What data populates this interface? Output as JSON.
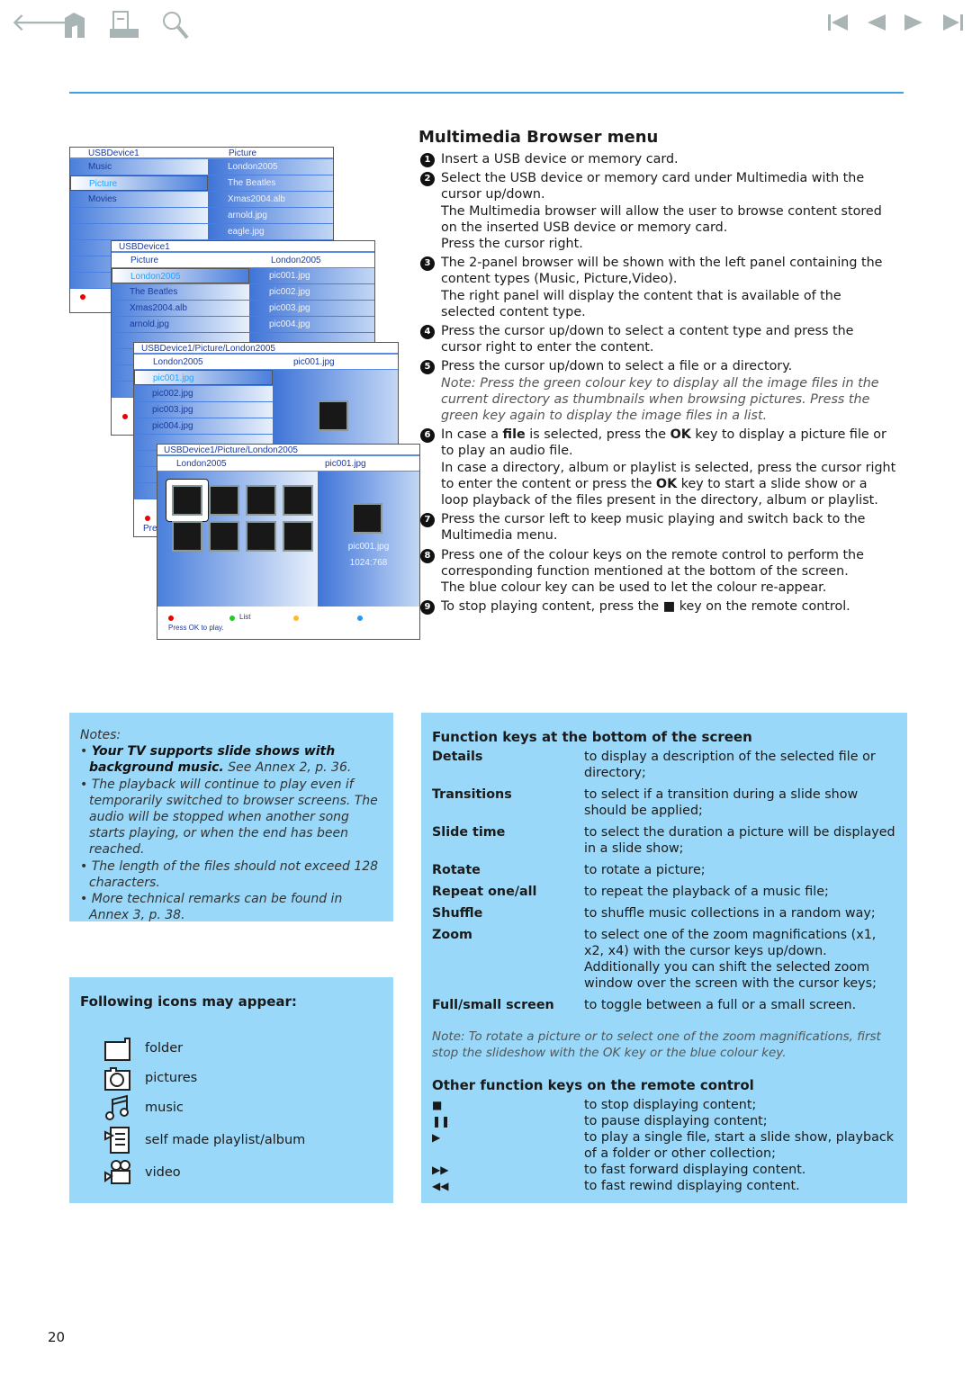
{
  "nav": {
    "left_icons": [
      "back-arrow-icon",
      "home-icon",
      "print-icon",
      "search-icon"
    ],
    "right_icons": [
      "first-page-icon",
      "previous-page-icon",
      "next-page-icon",
      "last-page-icon"
    ]
  },
  "colors": {
    "rule": "#3aa2e6",
    "box": "#99d8f8",
    "screen_blue": "#4a7fdc"
  },
  "screens": [
    {
      "header_left": "USBDevice1",
      "header_right": "Picture",
      "left": [
        "Music",
        "Picture",
        "Movies",
        "",
        ""
      ],
      "right": [
        "London2005",
        "The Beatles",
        "Xmas2004.alb",
        "arnold.jpg",
        "eagle.jpg"
      ],
      "selected": 1
    },
    {
      "header": "USBDevice1",
      "sub_left": "Picture",
      "sub_right": "London2005",
      "left": [
        "London2005",
        "The Beatles",
        "Xmas2004.alb",
        "arnold.jpg"
      ],
      "right": [
        "pic001.jpg",
        "pic002.jpg",
        "pic003.jpg",
        "pic004.jpg"
      ],
      "foot": "Pre"
    },
    {
      "header": "USBDevice1/Picture/London2005",
      "sub_left": "London2005",
      "sub_right": "pic001.jpg",
      "left": [
        "pic001.jpg",
        "pic002.jpg",
        "pic003.jpg",
        "pic004.jpg"
      ],
      "foot": "Pre"
    },
    {
      "header": "USBDevice1/Picture/London2005",
      "sub_left": "London2005",
      "sub_right": "pic001.jpg",
      "preview_name": "pic001.jpg",
      "preview_res": "1024:768",
      "green_label": "List",
      "foot": "Press OK to play."
    }
  ],
  "main": {
    "title": "Multimedia Browser menu",
    "steps": [
      {
        "n": "1",
        "lines": [
          "Insert a USB device or memory card."
        ]
      },
      {
        "n": "2",
        "lines": [
          "Select the USB device or memory card under Multimedia with the cursor up/down.",
          "The Multimedia browser will allow the user to browse content stored on the inserted USB device or memory card.",
          "Press the cursor right."
        ]
      },
      {
        "n": "3",
        "lines": [
          "The 2-panel browser will be shown with the left panel containing the content types (Music, Picture,Video).",
          "The right panel will display the content that is available of the selected content type."
        ]
      },
      {
        "n": "4",
        "lines": [
          "Press the cursor up/down to select a content type and press the cursor right to enter the content."
        ]
      },
      {
        "n": "5",
        "lines": [
          "Press the cursor up/down to select a file or a directory."
        ],
        "note": "Note: Press the green colour key to display all the image files in the current directory as thumbnails when browsing pictures. Press the green key again to display the image files in a list."
      },
      {
        "n": "6",
        "a1": "In case a ",
        "file": "file",
        "a2": " is selected, press the ",
        "ok": "OK",
        "a3": " key to display a picture file or to play an audio file.",
        "b1": "In case a directory, album or playlist is selected, press the cursor right to enter the content or press the ",
        "ok2": "OK",
        "b2": " key to start a slide show or a loop playback of the files present in the directory, album or playlist."
      },
      {
        "n": "7",
        "lines": [
          "Press the cursor left to keep music playing and switch back to the Multimedia menu."
        ]
      },
      {
        "n": "8",
        "lines": [
          "Press one of the colour keys on the remote control to perform the corresponding function mentioned at the bottom of the screen.",
          "The blue colour key can be used to let the colour re-appear."
        ]
      },
      {
        "n": "9",
        "t1": "To stop playing content, press the",
        "sym": "■",
        "t2": "key on the remote control."
      }
    ]
  },
  "notes": {
    "heading": "Notes:",
    "items": [
      {
        "bold": "Your TV supports slide shows with background music.",
        "rest": " See Annex 2, p. 36."
      },
      {
        "rest": "The playback will continue to play even if temporarily switched to browser screens. The audio will be stopped when another song starts playing, or when the end has been reached."
      },
      {
        "rest": "The length of the files should not exceed 128 characters."
      },
      {
        "rest": "More technical remarks can be found in Annex 3, p. 38."
      }
    ]
  },
  "icons_box": {
    "title": "Following icons may appear:",
    "items": [
      {
        "icon": "folder-icon",
        "label": "folder"
      },
      {
        "icon": "camera-icon",
        "label": "pictures"
      },
      {
        "icon": "music-note-icon",
        "label": "music"
      },
      {
        "icon": "playlist-icon",
        "label": "self made playlist/album"
      },
      {
        "icon": "video-camera-icon",
        "label": "video"
      }
    ]
  },
  "function_keys": {
    "title": "Function keys at the bottom of the screen",
    "rows": [
      {
        "key": "Details",
        "desc": "to display a description of the selected file or directory;"
      },
      {
        "key": "Transitions",
        "desc": "to select if a transition during a slide show should be applied;"
      },
      {
        "key": "Slide time",
        "desc": "to select the duration a picture will be displayed in a slide show;"
      },
      {
        "key": "Rotate",
        "desc": "to rotate a picture;"
      },
      {
        "key": "Repeat one/all",
        "desc": "to repeat the playback of a music file;"
      },
      {
        "key": "Shuffle",
        "desc": "to shuffle music collections in a random way;"
      },
      {
        "key": "Zoom",
        "desc": "to select one of the zoom magnifications (x1, x2, x4) with the cursor keys up/down. Additionally you can shift the selected zoom window over the screen with the cursor keys;"
      },
      {
        "key": "Full/small screen",
        "desc": "to toggle between a full or a small screen."
      }
    ],
    "note": "Note: To rotate a picture or to select one of the zoom magnifications, first stop the slideshow with the OK key or the blue colour key.",
    "other_title": "Other function keys on the remote control",
    "other": [
      {
        "key": "■",
        "desc": "to stop displaying content;"
      },
      {
        "key": "❚❚",
        "desc": "to pause displaying content;"
      },
      {
        "key": "▶",
        "desc": "to play a single file, start a slide show, playback of a folder or other collection;"
      },
      {
        "key": "▶▶",
        "desc": "to fast forward displaying content."
      },
      {
        "key": "◀◀",
        "desc": "to fast rewind displaying content."
      }
    ]
  },
  "page_number": "20"
}
